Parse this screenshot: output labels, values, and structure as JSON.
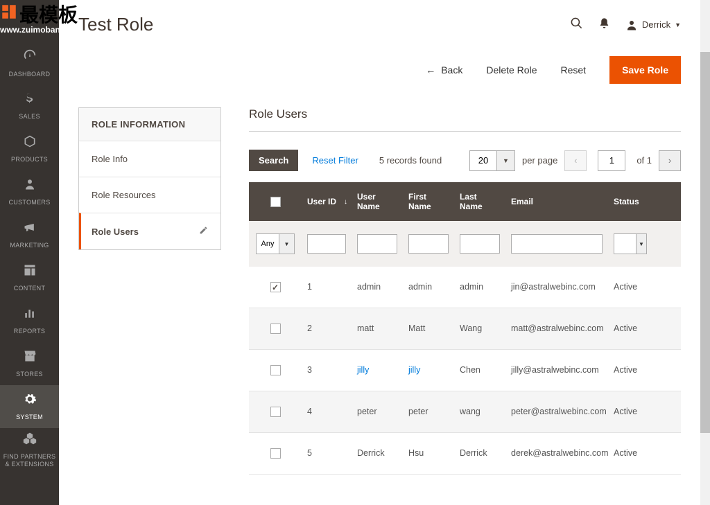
{
  "watermark": {
    "logo": "最模板",
    "url": "www.zuimoban.com"
  },
  "sidebar": [
    {
      "label": "DASHBOARD",
      "icon": "gauge",
      "active": false
    },
    {
      "label": "SALES",
      "icon": "dollar",
      "active": false
    },
    {
      "label": "PRODUCTS",
      "icon": "cube",
      "active": false
    },
    {
      "label": "CUSTOMERS",
      "icon": "person",
      "active": false
    },
    {
      "label": "MARKETING",
      "icon": "megaphone",
      "active": false
    },
    {
      "label": "CONTENT",
      "icon": "layout",
      "active": false
    },
    {
      "label": "REPORTS",
      "icon": "bars",
      "active": false
    },
    {
      "label": "STORES",
      "icon": "storefront",
      "active": false
    },
    {
      "label": "SYSTEM",
      "icon": "gear",
      "active": true
    },
    {
      "label": "FIND PARTNERS & EXTENSIONS",
      "icon": "cubes",
      "active": false
    }
  ],
  "page_title": "Test Role",
  "user": {
    "name": "Derrick"
  },
  "actions": {
    "back": "Back",
    "delete": "Delete Role",
    "reset": "Reset",
    "save": "Save Role"
  },
  "tabs": {
    "title": "ROLE INFORMATION",
    "items": [
      {
        "label": "Role Info",
        "active": false
      },
      {
        "label": "Role Resources",
        "active": false
      },
      {
        "label": "Role Users",
        "active": true,
        "editable": true
      }
    ]
  },
  "main": {
    "title": "Role Users",
    "search": "Search",
    "reset_filter": "Reset Filter",
    "records": "5 records found",
    "per_page_value": "20",
    "per_page_label": "per page",
    "page_current": "1",
    "page_of": "of 1",
    "filter_any": "Any",
    "columns": {
      "user_id": "User ID",
      "user_name": "User Name",
      "first_name": "First Name",
      "last_name": "Last Name",
      "email": "Email",
      "status": "Status"
    },
    "rows": [
      {
        "checked": true,
        "id": "1",
        "username": "admin",
        "first": "admin",
        "last": "admin",
        "email": "jin@astralwebinc.com",
        "status": "Active",
        "link": false
      },
      {
        "checked": false,
        "id": "2",
        "username": "matt",
        "first": "Matt",
        "last": "Wang",
        "email": "matt@astralwebinc.com",
        "status": "Active",
        "link": false
      },
      {
        "checked": false,
        "id": "3",
        "username": "jilly",
        "first": "jilly",
        "last": "Chen",
        "email": "jilly@astralwebinc.com",
        "status": "Active",
        "link": true
      },
      {
        "checked": false,
        "id": "4",
        "username": "peter",
        "first": "peter",
        "last": "wang",
        "email": "peter@astralwebinc.com",
        "status": "Active",
        "link": false
      },
      {
        "checked": false,
        "id": "5",
        "username": "Derrick",
        "first": "Hsu",
        "last": "Derrick",
        "email": "derek@astralwebinc.com",
        "status": "Active",
        "link": false
      }
    ]
  }
}
